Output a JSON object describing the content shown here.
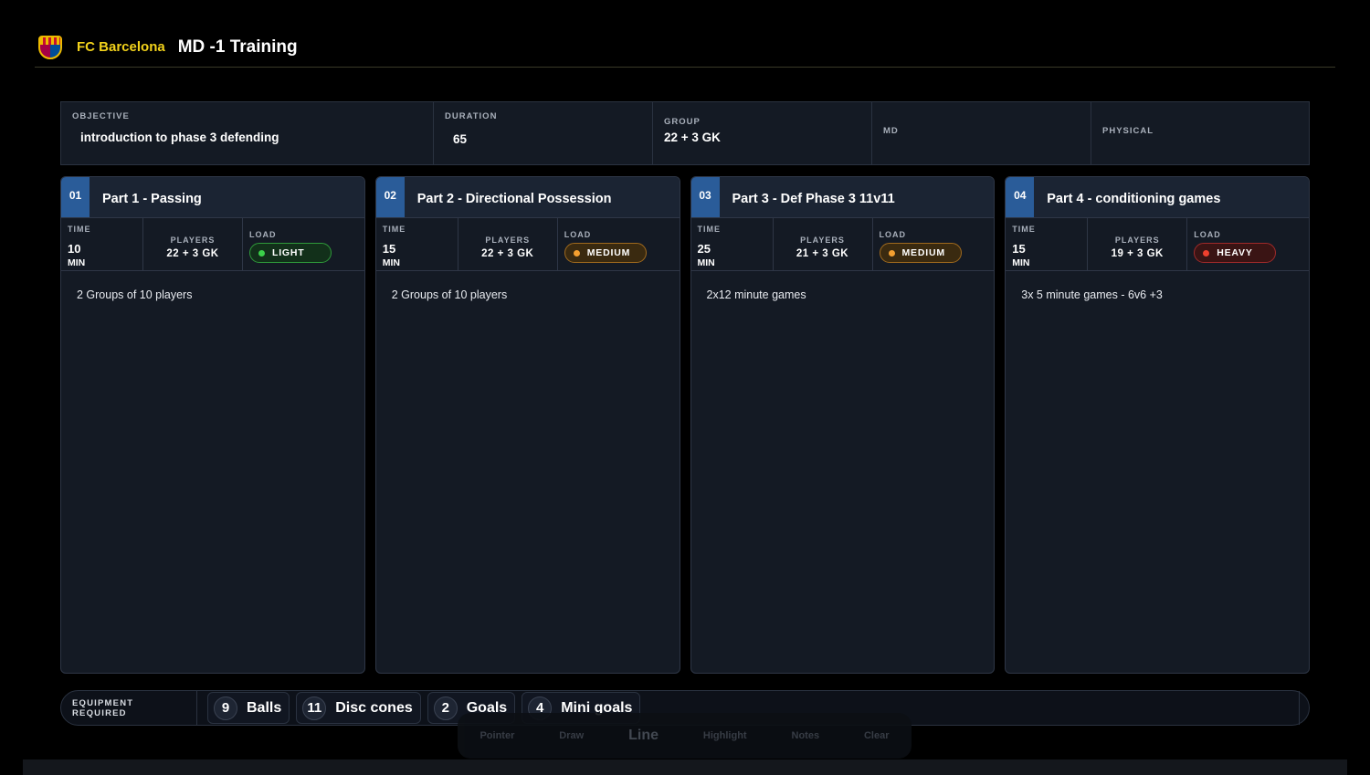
{
  "header": {
    "club_name": "FC Barcelona",
    "session_title": "MD -1 Training",
    "crest_icon": "fc-barcelona-crest-icon"
  },
  "info": {
    "objective_label": "OBJECTIVE",
    "objective_value": "introduction to phase 3 defending",
    "duration_label": "DURATION",
    "duration_value": "65",
    "group_label": "GROUP",
    "group_value": "22 + 3 GK",
    "md_label": "MD",
    "md_value": "",
    "physical_label": "PHYSICAL",
    "physical_value": ""
  },
  "stat_labels": {
    "time": "TIME",
    "players": "PLAYERS",
    "load": "LOAD",
    "unit": "MIN"
  },
  "parts": [
    {
      "num": "01",
      "title": "Part 1 - Passing",
      "time": "10",
      "players": "22 + 3 GK",
      "load": "LIGHT",
      "desc": "2 Groups of 10 players"
    },
    {
      "num": "02",
      "title": "Part 2 - Directional Possession",
      "time": "15",
      "players": "22 + 3 GK",
      "load": "MEDIUM",
      "desc": "2 Groups of 10 players"
    },
    {
      "num": "03",
      "title": "Part 3 - Def Phase 3 11v11",
      "time": "25",
      "players": "21 + 3 GK",
      "load": "MEDIUM",
      "desc": "2x12 minute games"
    },
    {
      "num": "04",
      "title": "Part 4 - conditioning games",
      "time": "15",
      "players": "19 + 3 GK",
      "load": "HEAVY",
      "desc": "3x 5 minute games - 6v6 +3"
    }
  ],
  "equipment": {
    "label": "EQUIPMENT REQUIRED",
    "items": [
      {
        "count": "9",
        "name": "Balls"
      },
      {
        "count": "11",
        "name": "Disc cones"
      },
      {
        "count": "2",
        "name": "Goals"
      },
      {
        "count": "4",
        "name": "Mini goals"
      }
    ]
  },
  "toolbar": {
    "pointer": "Pointer",
    "draw": "Draw",
    "line": "Line",
    "highlight": "Highlight",
    "notes": "Notes",
    "clear": "Clear",
    "active": "Line"
  },
  "colors": {
    "club_accent": "#f2d21b",
    "part_number_bg": "#2a5c99",
    "load_light": "#3bd14a",
    "load_medium": "#f5a030",
    "load_heavy": "#f0402e"
  }
}
